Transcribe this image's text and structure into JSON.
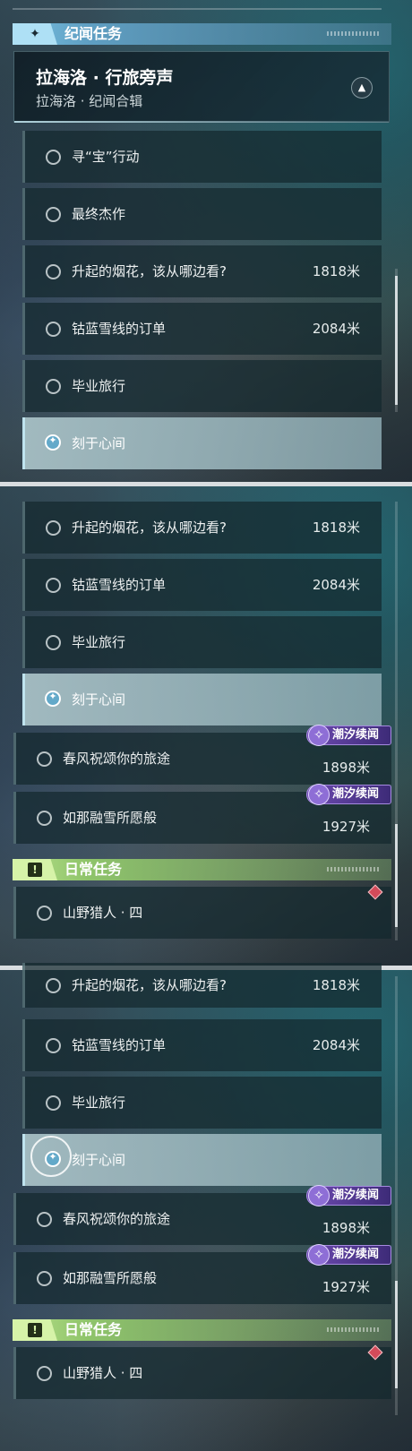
{
  "story_section": {
    "title": "纪闻任务",
    "icon": "sparkle-icon",
    "accent": "#77bfe0",
    "chapter": {
      "title": "拉海洛 · 行旅旁声",
      "subtitle": "拉海洛 · 纪闻合辑"
    }
  },
  "tide_badge": "潮汐续闻",
  "daily_section": {
    "title": "日常任务",
    "icon": "exclamation-icon",
    "accent": "#b7e08a"
  },
  "tasks": {
    "treasure": {
      "label": "寻“宝”行动"
    },
    "masterpiece": {
      "label": "最终杰作"
    },
    "fireworks": {
      "label": "升起的烟花，该从哪边看?",
      "distance": "1818米"
    },
    "cobalt": {
      "label": "钴蓝雪线的订单",
      "distance": "2084米"
    },
    "graduation": {
      "label": "毕业旅行",
      "distance": ""
    },
    "heart": {
      "label": "刻于心间"
    },
    "spring": {
      "label": "春风祝颂你的旅途",
      "distance": "1898米"
    },
    "snowmelt": {
      "label": "如那融雪所愿般",
      "distance": "1927米"
    },
    "hunter": {
      "label": "山野猎人 · 四"
    }
  }
}
